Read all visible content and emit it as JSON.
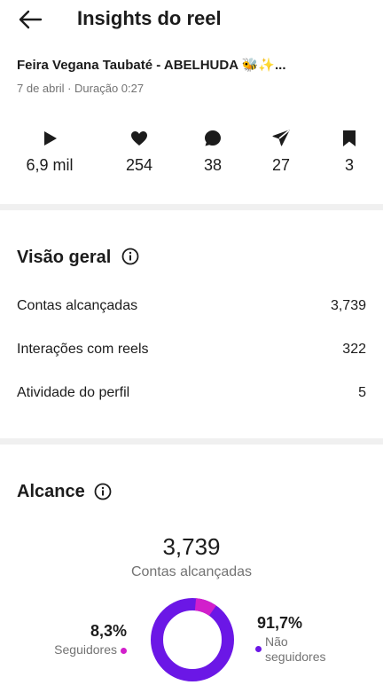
{
  "header": {
    "title": "Insights do reel"
  },
  "reel": {
    "title": "Feira Vegana Taubaté - ABELHUDA 🐝✨...",
    "meta": "7 de abril · Duração 0:27"
  },
  "stats": [
    {
      "icon": "play-icon",
      "value": "6,9 mil"
    },
    {
      "icon": "heart-icon",
      "value": "254"
    },
    {
      "icon": "comment-icon",
      "value": "38"
    },
    {
      "icon": "share-icon",
      "value": "27"
    },
    {
      "icon": "bookmark-icon",
      "value": "3"
    }
  ],
  "overview": {
    "title": "Visão geral",
    "rows": [
      {
        "label": "Contas alcançadas",
        "value": "3,739"
      },
      {
        "label": "Interações com reels",
        "value": "322"
      },
      {
        "label": "Atividade do perfil",
        "value": "5"
      }
    ]
  },
  "reach": {
    "title": "Alcance",
    "total": "3,739",
    "total_label": "Contas alcançadas",
    "followers": {
      "pct": "8,3%",
      "label": "Seguidores",
      "fraction": 0.083,
      "color": "#d21fcb"
    },
    "non_followers": {
      "pct": "91,7%",
      "label": "Não seguidores",
      "fraction": 0.917,
      "color": "#6b17e6"
    }
  },
  "colors": {
    "separator": "#f0f0f0",
    "muted_text": "#737373"
  }
}
